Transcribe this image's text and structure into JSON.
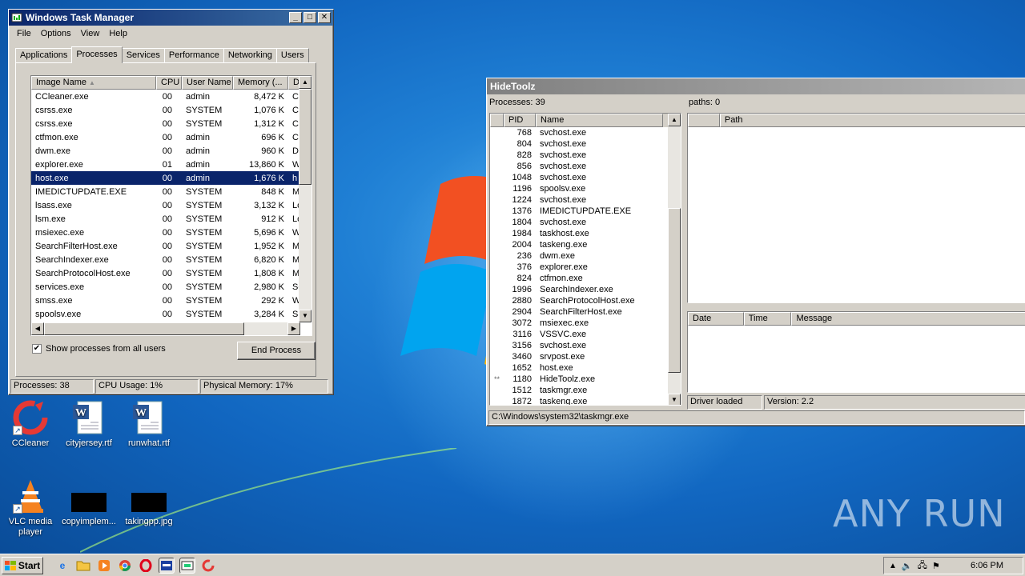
{
  "desktop": {
    "icons": [
      {
        "label": "CCleaner",
        "icon": "ccleaner-icon"
      },
      {
        "label": "cityjersey.rtf",
        "icon": "word-document-icon"
      },
      {
        "label": "runwhat.rtf",
        "icon": "word-document-icon"
      },
      {
        "label": "VLC media player",
        "icon": "vlc-icon"
      },
      {
        "label": "copyimplem...",
        "icon": "image-file-icon"
      },
      {
        "label": "takingpp.jpg",
        "icon": "image-file-icon"
      }
    ],
    "watermark": "ANY RUN"
  },
  "task_manager": {
    "title": "Windows Task Manager",
    "menu": [
      "File",
      "Options",
      "View",
      "Help"
    ],
    "tabs": [
      "Applications",
      "Processes",
      "Services",
      "Performance",
      "Networking",
      "Users"
    ],
    "active_tab": "Processes",
    "columns": [
      "Image Name",
      "CPU",
      "User Name",
      "Memory (...",
      "D"
    ],
    "rows": [
      {
        "name": "CCleaner.exe",
        "cpu": "00",
        "user": "admin",
        "mem": "8,472 K",
        "d": "C"
      },
      {
        "name": "csrss.exe",
        "cpu": "00",
        "user": "SYSTEM",
        "mem": "1,076 K",
        "d": "C"
      },
      {
        "name": "csrss.exe",
        "cpu": "00",
        "user": "SYSTEM",
        "mem": "1,312 K",
        "d": "C"
      },
      {
        "name": "ctfmon.exe",
        "cpu": "00",
        "user": "admin",
        "mem": "696 K",
        "d": "C"
      },
      {
        "name": "dwm.exe",
        "cpu": "00",
        "user": "admin",
        "mem": "960 K",
        "d": "D"
      },
      {
        "name": "explorer.exe",
        "cpu": "01",
        "user": "admin",
        "mem": "13,860 K",
        "d": "W"
      },
      {
        "name": "host.exe",
        "cpu": "00",
        "user": "admin",
        "mem": "1,676 K",
        "d": "h"
      },
      {
        "name": "IMEDICTUPDATE.EXE",
        "cpu": "00",
        "user": "SYSTEM",
        "mem": "848 K",
        "d": "M"
      },
      {
        "name": "lsass.exe",
        "cpu": "00",
        "user": "SYSTEM",
        "mem": "3,132 K",
        "d": "Lo"
      },
      {
        "name": "lsm.exe",
        "cpu": "00",
        "user": "SYSTEM",
        "mem": "912 K",
        "d": "Lo"
      },
      {
        "name": "msiexec.exe",
        "cpu": "00",
        "user": "SYSTEM",
        "mem": "5,696 K",
        "d": "W"
      },
      {
        "name": "SearchFilterHost.exe",
        "cpu": "00",
        "user": "SYSTEM",
        "mem": "1,952 K",
        "d": "M"
      },
      {
        "name": "SearchIndexer.exe",
        "cpu": "00",
        "user": "SYSTEM",
        "mem": "6,820 K",
        "d": "M"
      },
      {
        "name": "SearchProtocolHost.exe",
        "cpu": "00",
        "user": "SYSTEM",
        "mem": "1,808 K",
        "d": "M"
      },
      {
        "name": "services.exe",
        "cpu": "00",
        "user": "SYSTEM",
        "mem": "2,980 K",
        "d": "Se"
      },
      {
        "name": "smss.exe",
        "cpu": "00",
        "user": "SYSTEM",
        "mem": "292 K",
        "d": "W"
      },
      {
        "name": "spoolsv.exe",
        "cpu": "00",
        "user": "SYSTEM",
        "mem": "3,284 K",
        "d": "Sp"
      }
    ],
    "selected_index": 6,
    "show_all_label": "Show processes from all users",
    "show_all_checked": true,
    "end_process_label": "End Process",
    "status": {
      "processes": "Processes: 38",
      "cpu": "CPU Usage: 1%",
      "memory": "Physical Memory: 17%"
    }
  },
  "hidetoolz": {
    "title": "HideToolz",
    "processes_count": "Processes: 39",
    "paths_count": "paths: 0",
    "proc_columns": [
      "PID",
      "Name"
    ],
    "proc_rows": [
      {
        "mark": "",
        "pid": "768",
        "name": "svchost.exe"
      },
      {
        "mark": "",
        "pid": "804",
        "name": "svchost.exe"
      },
      {
        "mark": "",
        "pid": "828",
        "name": "svchost.exe"
      },
      {
        "mark": "",
        "pid": "856",
        "name": "svchost.exe"
      },
      {
        "mark": "",
        "pid": "1048",
        "name": "svchost.exe"
      },
      {
        "mark": "",
        "pid": "1196",
        "name": "spoolsv.exe"
      },
      {
        "mark": "",
        "pid": "1224",
        "name": "svchost.exe"
      },
      {
        "mark": "",
        "pid": "1376",
        "name": "IMEDICTUPDATE.EXE"
      },
      {
        "mark": "",
        "pid": "1804",
        "name": "svchost.exe"
      },
      {
        "mark": "",
        "pid": "1984",
        "name": "taskhost.exe"
      },
      {
        "mark": "",
        "pid": "2004",
        "name": "taskeng.exe"
      },
      {
        "mark": "",
        "pid": "236",
        "name": "dwm.exe"
      },
      {
        "mark": "",
        "pid": "376",
        "name": "explorer.exe"
      },
      {
        "mark": "",
        "pid": "824",
        "name": "ctfmon.exe"
      },
      {
        "mark": "",
        "pid": "1996",
        "name": "SearchIndexer.exe"
      },
      {
        "mark": "",
        "pid": "2880",
        "name": "SearchProtocolHost.exe"
      },
      {
        "mark": "",
        "pid": "2904",
        "name": "SearchFilterHost.exe"
      },
      {
        "mark": "",
        "pid": "3072",
        "name": "msiexec.exe"
      },
      {
        "mark": "",
        "pid": "3116",
        "name": "VSSVC.exe"
      },
      {
        "mark": "",
        "pid": "3156",
        "name": "svchost.exe"
      },
      {
        "mark": "",
        "pid": "3460",
        "name": "srvpost.exe"
      },
      {
        "mark": "",
        "pid": "1652",
        "name": "host.exe"
      },
      {
        "mark": "**",
        "pid": "1180",
        "name": "HideToolz.exe"
      },
      {
        "mark": "",
        "pid": "1512",
        "name": "taskmgr.exe"
      },
      {
        "mark": "",
        "pid": "1872",
        "name": "taskeng.exe"
      }
    ],
    "path_columns": [
      "Path"
    ],
    "log_columns": [
      "Date",
      "Time",
      "Message"
    ],
    "status_driver": "Driver loaded",
    "status_version": "Version: 2.2",
    "status_path": "C:\\Windows\\system32\\taskmgr.exe"
  },
  "taskbar": {
    "start_label": "Start",
    "clock": "6:06 PM",
    "quick_launch": [
      "ie-icon",
      "folder-icon",
      "media-player-icon",
      "chrome-icon",
      "opera-icon",
      "task-manager-icon",
      "hidetoolz-icon",
      "ccleaner-icon"
    ]
  }
}
